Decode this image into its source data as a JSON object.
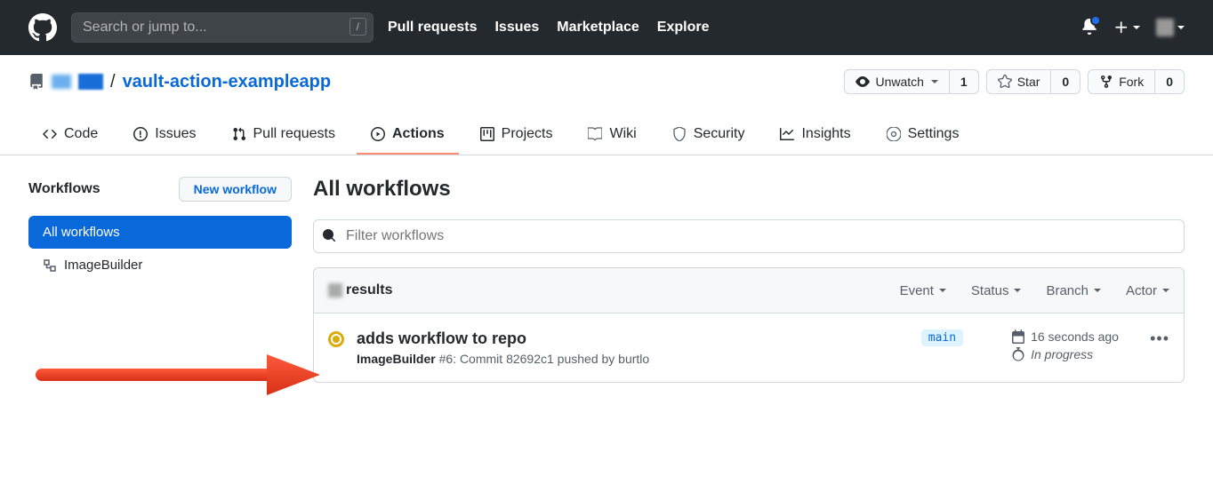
{
  "header": {
    "search_placeholder": "Search or jump to...",
    "nav": {
      "pulls": "Pull requests",
      "issues": "Issues",
      "marketplace": "Marketplace",
      "explore": "Explore"
    }
  },
  "repo": {
    "name": "vault-action-exampleapp",
    "separator": "/",
    "unwatch": "Unwatch",
    "unwatch_count": "1",
    "star": "Star",
    "star_count": "0",
    "fork": "Fork",
    "fork_count": "0"
  },
  "tabs": {
    "code": "Code",
    "issues": "Issues",
    "pulls": "Pull requests",
    "actions": "Actions",
    "projects": "Projects",
    "wiki": "Wiki",
    "security": "Security",
    "insights": "Insights",
    "settings": "Settings"
  },
  "sidebar": {
    "title": "Workflows",
    "new_btn": "New workflow",
    "items": {
      "all": "All workflows",
      "imagebuilder": "ImageBuilder"
    }
  },
  "content": {
    "title": "All workflows",
    "filter_placeholder": "Filter workflows",
    "results_label": "results",
    "filters": {
      "event": "Event",
      "status": "Status",
      "branch": "Branch",
      "actor": "Actor"
    },
    "run": {
      "title": "adds workflow to repo",
      "workflow": "ImageBuilder",
      "run_num": "#6",
      "commit_prefix": ": Commit ",
      "commit": "82692c1",
      "pushed_by_prefix": " pushed by ",
      "pusher": "burtlo",
      "branch": "main",
      "time": "16 seconds ago",
      "status": "In progress"
    }
  }
}
